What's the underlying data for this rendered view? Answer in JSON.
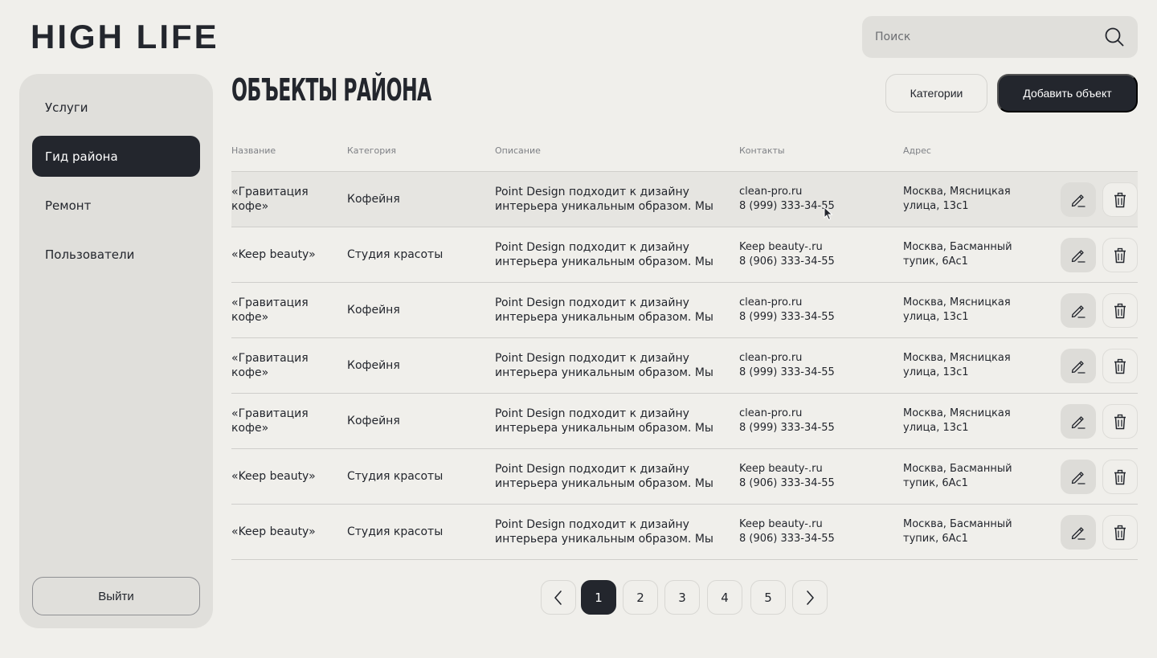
{
  "brand": {
    "logo": "HIGH LIFE"
  },
  "search": {
    "placeholder": "Поиск",
    "icon": "search-icon"
  },
  "sidebar": {
    "items": [
      {
        "label": "Услуги",
        "active": false
      },
      {
        "label": "Гид района",
        "active": true
      },
      {
        "label": "Ремонт",
        "active": false
      },
      {
        "label": "Пользователи",
        "active": false
      }
    ],
    "logout_label": "Выйти"
  },
  "main": {
    "title": "ОБЪЕКТЫ РАЙОНА",
    "categories_button": "Категории",
    "add_button": "Добавить объект"
  },
  "table": {
    "columns": [
      "Название",
      "Категория",
      "Описание",
      "Контакты",
      "Адрес"
    ],
    "rows": [
      {
        "name_1": "«Гравитация",
        "name_2": "кофе»",
        "category": "Кофейня",
        "desc_1": "Point Design подходит к дизайну",
        "desc_2": "интерьера уникальным образом. Мы",
        "site": "clean-pro.ru",
        "phone": "8 (999) 333-34-55",
        "addr_1": "Москва, Мясницкая",
        "addr_2": "улица, 13с1"
      },
      {
        "name_1": "«Keep beauty»",
        "name_2": "",
        "category": "Студия красоты",
        "desc_1": "Point Design подходит к дизайну",
        "desc_2": "интерьера уникальным образом. Мы",
        "site": "Keep beauty-.ru",
        "phone": "8 (906) 333-34-55",
        "addr_1": "Москва, Басманный",
        "addr_2": "тупик, 6Ас1"
      },
      {
        "name_1": "«Гравитация",
        "name_2": "кофе»",
        "category": "Кофейня",
        "desc_1": "Point Design подходит к дизайну",
        "desc_2": "интерьера уникальным образом. Мы",
        "site": "clean-pro.ru",
        "phone": "8 (999) 333-34-55",
        "addr_1": "Москва, Мясницкая",
        "addr_2": "улица, 13с1"
      },
      {
        "name_1": "«Гравитация",
        "name_2": "кофе»",
        "category": "Кофейня",
        "desc_1": "Point Design подходит к дизайну",
        "desc_2": "интерьера уникальным образом. Мы",
        "site": "clean-pro.ru",
        "phone": "8 (999) 333-34-55",
        "addr_1": "Москва, Мясницкая",
        "addr_2": "улица, 13с1"
      },
      {
        "name_1": "«Гравитация",
        "name_2": "кофе»",
        "category": "Кофейня",
        "desc_1": "Point Design подходит к дизайну",
        "desc_2": "интерьера уникальным образом. Мы",
        "site": "clean-pro.ru",
        "phone": "8 (999) 333-34-55",
        "addr_1": "Москва, Мясницкая",
        "addr_2": "улица, 13с1"
      },
      {
        "name_1": "«Keep beauty»",
        "name_2": "",
        "category": "Студия красоты",
        "desc_1": "Point Design подходит к дизайну",
        "desc_2": "интерьера уникальным образом. Мы",
        "site": "Keep beauty-.ru",
        "phone": "8 (906) 333-34-55",
        "addr_1": "Москва, Басманный",
        "addr_2": "тупик, 6Ас1"
      },
      {
        "name_1": "«Keep beauty»",
        "name_2": "",
        "category": "Студия красоты",
        "desc_1": "Point Design подходит к дизайну",
        "desc_2": "интерьера уникальным образом. Мы",
        "site": "Keep beauty-.ru",
        "phone": "8 (906) 333-34-55",
        "addr_1": "Москва, Басманный",
        "addr_2": "тупик, 6Ас1"
      }
    ],
    "actions": {
      "edit_icon": "pencil-icon",
      "delete_icon": "trash-icon"
    }
  },
  "pagination": {
    "pages": [
      "1",
      "2",
      "3",
      "4",
      "5"
    ],
    "current": "1",
    "prev_icon": "chevron-left-icon",
    "next_icon": "chevron-right-icon"
  },
  "colors": {
    "background": "#f0efeb",
    "panel": "#e0dfdb",
    "dark": "#23262d",
    "divider": "#cfcecb"
  }
}
